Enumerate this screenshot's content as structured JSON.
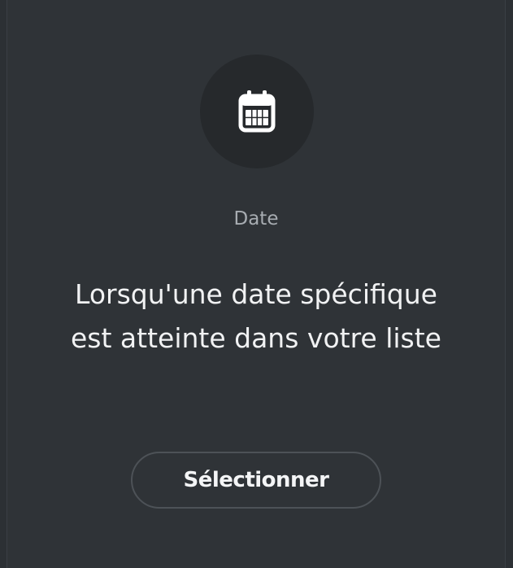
{
  "card": {
    "icon": "calendar-icon",
    "category": "Date",
    "description": "Lorsqu'une date spécifique est atteinte dans votre liste",
    "button_label": "Sélectionner"
  },
  "colors": {
    "background": "#2c3034",
    "card_background": "#2f3337",
    "icon_circle": "#26292c",
    "icon": "#ffffff",
    "category_text": "#a7acb1",
    "description_text": "#f1f2f3",
    "button_border": "#4d5257"
  }
}
